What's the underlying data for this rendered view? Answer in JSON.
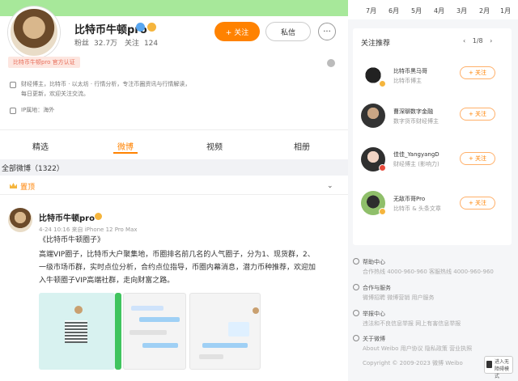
{
  "profile": {
    "name": "比特币牛顿pro",
    "stats": [
      "粉丝",
      "32.7万",
      "关注",
      "124"
    ],
    "follow_label": "+ 关注",
    "message_label": "私信",
    "more_label": "···",
    "badge_text": "比特币牛顿pro 官方认证",
    "bio_lines": [
      "财经博主，比特币 · 以太坊 · 行情分析，专注币圈资讯与行情解读，",
      "每日更新，欢迎关注交流。",
      "IP属地：海外"
    ]
  },
  "tabs": [
    "精选",
    "微博",
    "视频",
    "相册"
  ],
  "active_tab": "微博",
  "section_title": "全部微博（1322）",
  "pinned_label": "置顶",
  "post": {
    "author": "比特币牛顿pro",
    "meta": "4-24 10:16 来自 iPhone 12 Pro Max",
    "lines": [
      "《比特币牛顿圈子》",
      "高端VIP圈子，比特币大户聚集地，币圈排名前几名的人气圈子，分为1、现货群，2、",
      "一级市场币群，实时点位分析，合约点位指导，币圈内幕消息，潜力币种推荐，欢迎加",
      "入牛顿圈子VIP高端社群，走向财富之路。"
    ]
  },
  "right": {
    "top_tabs": [
      "7月",
      "6月",
      "5月",
      "4月",
      "3月",
      "2月",
      "1月"
    ],
    "rec_title": "关注推荐",
    "rec_pager": "1/8",
    "rec_follow_label": "+ 关注",
    "recommendations": [
      {
        "name": "比特币黑马哥",
        "desc": "比特币博主"
      },
      {
        "name": "曹深聊数字金融",
        "desc": "数字货币财经博主"
      },
      {
        "name": "佳佳_YangyangD",
        "desc": "财经博主 (影响力)"
      },
      {
        "name": "无敌币哥Pro",
        "desc": "比特币 & 头条文章"
      }
    ],
    "footer": [
      {
        "title": "帮助中心",
        "text": "合作热线 4000-960-960  客服热线 4000-960-960"
      },
      {
        "title": "合作与服务",
        "text": "微博招聘  微博营销  用户服务"
      },
      {
        "title": "举报中心",
        "text": "违法和不良信息举报  网上有害信息举报"
      },
      {
        "title": "关于微博",
        "text": "About Weibo  用户协议  隐私政策  营业执照"
      }
    ],
    "copyright": "Copyright © 2009-2023 微博 Weibo",
    "a11y_label": "进入无障碍模式"
  }
}
